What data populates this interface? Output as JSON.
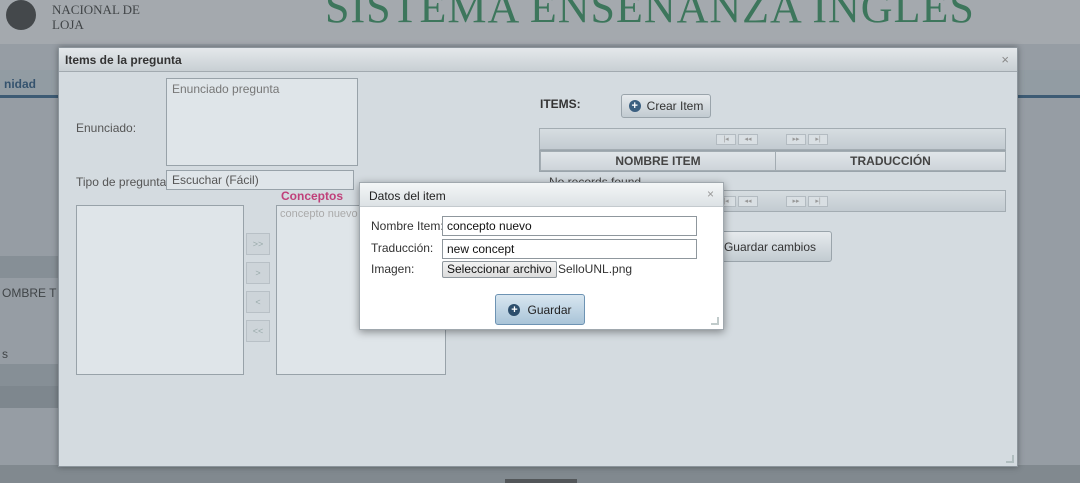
{
  "background": {
    "logo_line1": "NACIONAL DE",
    "logo_line2": "LOJA",
    "system_title": "SISTEMA ENSEÑANZA INGLÉS",
    "nav_partial": "nidad",
    "side_label": "OMBRE T",
    "side_label2": "s"
  },
  "dialog": {
    "title": "Items de la pregunta",
    "close_icon": "×",
    "enunciado_label": "Enunciado:",
    "enunciado_placeholder": "Enunciado pregunta",
    "tipo_label": "Tipo de pregunta:",
    "tipo_value": "Escuchar (Fácil)",
    "conceptos_title": "Conceptos",
    "concepto_item": "concepto nuevo",
    "items_label": "ITEMS:",
    "crear_item_label": "Crear Item",
    "grid_columns": [
      "NOMBRE ITEM",
      "TRADUCCIÓN"
    ],
    "no_records": "No records found.",
    "guardar_cambios_label": "Guardar cambios"
  },
  "item_dialog": {
    "title": "Datos del item",
    "close_icon": "×",
    "nombre_label": "Nombre Item:",
    "nombre_value": "concepto nuevo",
    "traduccion_label": "Traducción:",
    "traduccion_value": "new concept",
    "imagen_label": "Imagen:",
    "select_file_label": "Seleccionar archivo",
    "file_name": "SelloUNL.png",
    "guardar_label": "Guardar"
  }
}
